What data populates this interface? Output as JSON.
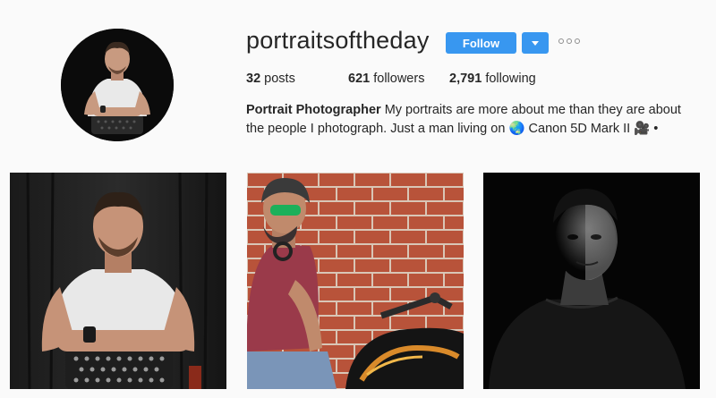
{
  "profile": {
    "username": "portraitsoftheday",
    "follow_label": "Follow",
    "avatar_icon": "profile-photo"
  },
  "stats": {
    "posts_count": "32",
    "posts_label": "posts",
    "followers_count": "621",
    "followers_label": "followers",
    "following_count": "2,791",
    "following_label": "following"
  },
  "bio": {
    "name": "Portrait Photographer",
    "text_1": "My portraits are more about me than they are about the people I photograph. Just a man living on",
    "globe_icon": "🌏",
    "text_2": "Canon 5D Mark II",
    "camera_icon": "🎥",
    "text_3": "•"
  },
  "posts": [
    {
      "icon": "photo-man-white-tshirt"
    },
    {
      "icon": "photo-man-brick-wall-motorcycle"
    },
    {
      "icon": "photo-man-dark-portrait"
    }
  ],
  "colors": {
    "accent": "#3897f0",
    "background": "#fafafa",
    "text": "#262626"
  }
}
